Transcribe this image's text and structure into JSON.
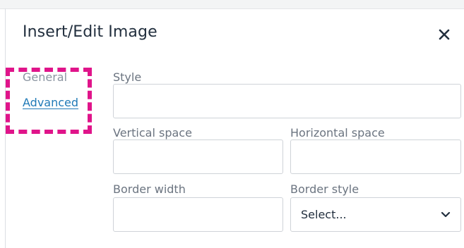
{
  "dialog": {
    "title": "Insert/Edit Image",
    "close_icon": "close-icon"
  },
  "tabs": [
    {
      "label": "General",
      "active": false
    },
    {
      "label": "Advanced",
      "active": true
    }
  ],
  "fields": {
    "style": {
      "label": "Style",
      "value": ""
    },
    "vertical_space": {
      "label": "Vertical space",
      "value": ""
    },
    "horizontal_space": {
      "label": "Horizontal space",
      "value": ""
    },
    "border_width": {
      "label": "Border width",
      "value": ""
    },
    "border_style": {
      "label": "Border style",
      "selected": "Select...",
      "icon": "chevron-down-icon"
    }
  },
  "colors": {
    "accent": "#207ab7",
    "highlight": "#e0148a",
    "title": "#222f3e",
    "label": "#6b7480"
  }
}
